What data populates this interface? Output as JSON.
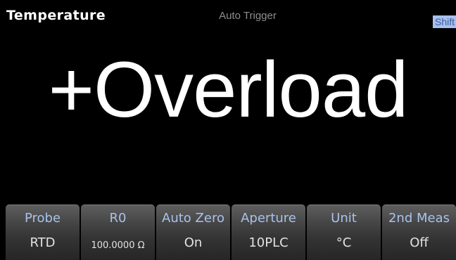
{
  "header": {
    "mode_title": "Temperature",
    "trigger_status": "Auto Trigger",
    "shift_indicator": "Shift"
  },
  "main": {
    "reading": "+Overload"
  },
  "softkeys": [
    {
      "label": "Probe",
      "value": "RTD"
    },
    {
      "label": "R0",
      "value": "100.0000 Ω"
    },
    {
      "label": "Auto Zero",
      "value": "On"
    },
    {
      "label": "Aperture",
      "value": "10PLC"
    },
    {
      "label": "Unit",
      "value": "°C"
    },
    {
      "label": "2nd Meas",
      "value": "Off"
    }
  ],
  "colors": {
    "background": "#000000",
    "softkey_label": "#a9c2ec",
    "shift_badge": "#a7c0ee"
  }
}
